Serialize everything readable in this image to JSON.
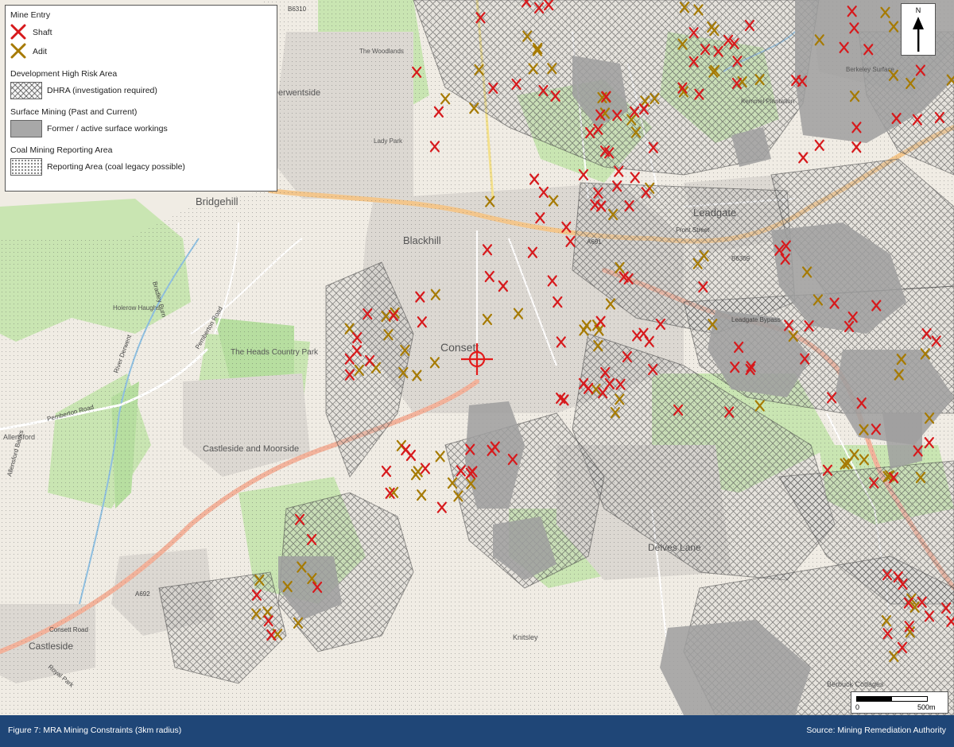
{
  "legend": {
    "mine_entry": {
      "title": "Mine Entry",
      "shaft_label": "Shaft",
      "adit_label": "Adit",
      "shaft_color": "#d7191c",
      "adit_color": "#a67a00"
    },
    "dhra": {
      "title": "Development High Risk Area",
      "label": "DHRA (investigation required)"
    },
    "surface": {
      "title": "Surface Mining (Past and Current)",
      "label": "Former / active surface workings"
    },
    "reporting": {
      "title": "Coal Mining Reporting Area",
      "label": "Reporting Area (coal legacy possible)"
    }
  },
  "north_arrow": {
    "label": "N"
  },
  "scale_bar": {
    "start": "0",
    "end": "500m"
  },
  "footer": {
    "caption": "Figure 7: MRA Mining Constraints (3km radius)",
    "source": "Source: Mining Remediation Authority"
  },
  "map": {
    "place_labels": [
      "Bridgehill",
      "Blackhill",
      "Consett",
      "Leadgate",
      "Castleside and Moorside",
      "Castleside",
      "Delves Lane",
      "Knitsley",
      "Allensford",
      "The Heads Country Park",
      "Holerow Haughs",
      "The Woodlands",
      "Berkeley Surface",
      "Derwentside",
      "Lady Park",
      "Kemmel Plantation",
      "Berbuck Cottages"
    ],
    "road_labels": [
      "B6310",
      "A692",
      "A691",
      "B6309",
      "Consett Road",
      "Pemberton Road",
      "Allensford Banks",
      "Pemberton Road",
      "River Derwent",
      "Bradley Burn",
      "Leadgate Bypass",
      "Front Street",
      "Royal Park"
    ],
    "shaft_count": 150,
    "adit_count": 100,
    "site_marker": "site-centre"
  }
}
